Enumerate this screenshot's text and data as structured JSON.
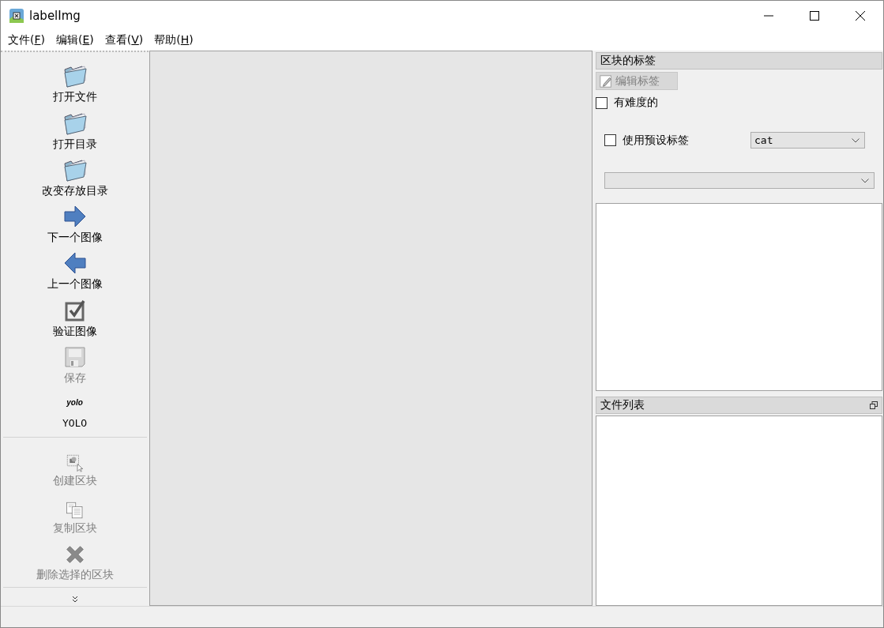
{
  "window": {
    "title": "labelImg"
  },
  "menu": [
    {
      "label": [
        "文件(",
        "F",
        ")"
      ]
    },
    {
      "label": [
        "编辑(",
        "E",
        ")"
      ]
    },
    {
      "label": [
        "查看(",
        "V",
        ")"
      ]
    },
    {
      "label": [
        "帮助(",
        "H",
        ")"
      ]
    }
  ],
  "toolbar": {
    "groups": [
      [
        {
          "kind": "folder",
          "label": "打开文件",
          "disabled": false
        },
        {
          "kind": "folder",
          "label": "打开目录",
          "disabled": false
        },
        {
          "kind": "folder",
          "label": "改变存放目录",
          "disabled": false
        },
        {
          "kind": "next",
          "label": "下一个图像",
          "disabled": false
        },
        {
          "kind": "prev",
          "label": "上一个图像",
          "disabled": false
        },
        {
          "kind": "verify",
          "label": "验证图像",
          "disabled": false
        },
        {
          "kind": "save",
          "label": "保存",
          "disabled": true
        },
        {
          "kind": "text",
          "icon_text": "yolo",
          "label": "YOLO",
          "disabled": false
        }
      ],
      [
        {
          "kind": "create",
          "label": "创建区块",
          "disabled": true
        },
        {
          "kind": "copy",
          "label": "复制区块",
          "disabled": true
        },
        {
          "kind": "delete",
          "label": "删除选择的区块",
          "disabled": true
        }
      ]
    ]
  },
  "label_dock": {
    "title": "区块的标签",
    "edit_button": {
      "label": "编辑标签",
      "disabled": true
    },
    "difficult": {
      "label": "有难度的",
      "checked": false
    },
    "use_default": {
      "label": "使用预设标签",
      "checked": false,
      "value": "cat"
    }
  },
  "file_dock": {
    "title": "文件列表"
  }
}
